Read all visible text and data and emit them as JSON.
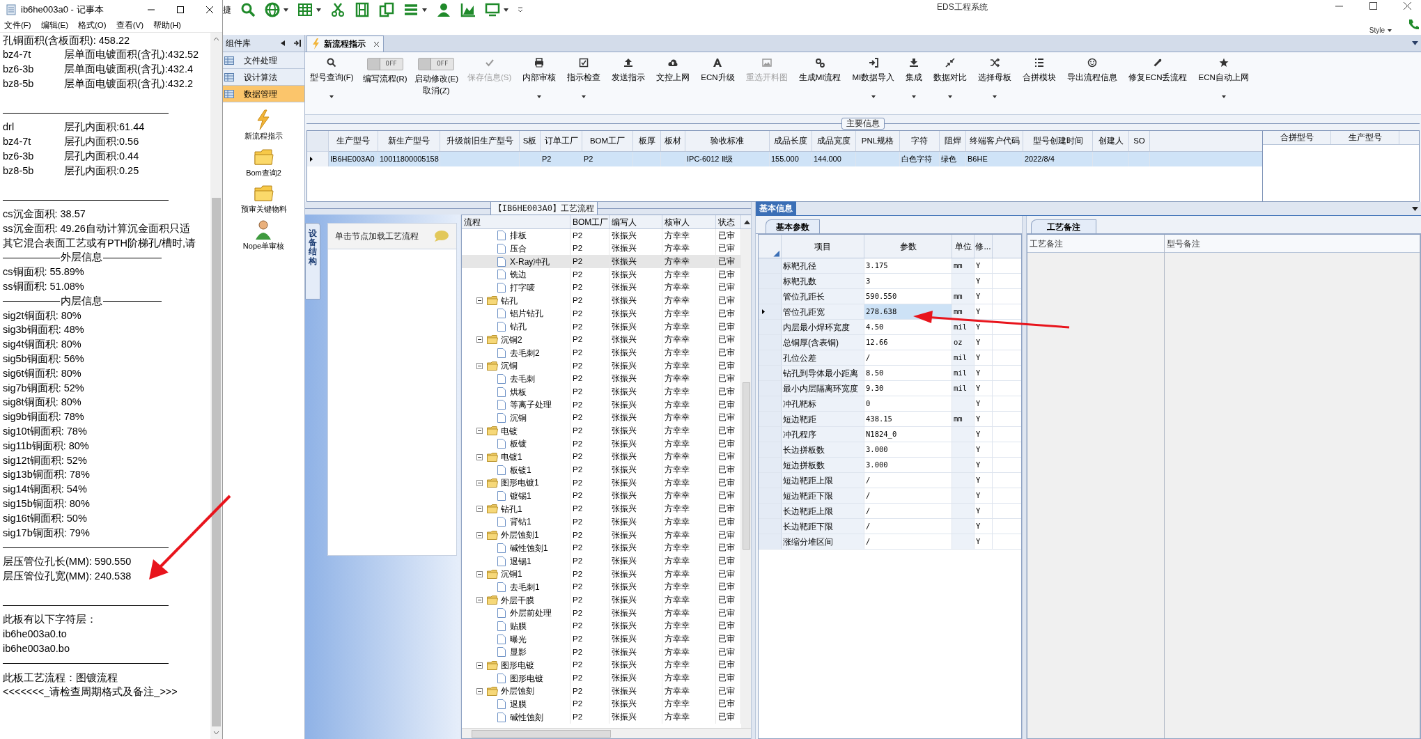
{
  "notepad": {
    "title": "ib6he003a0 - 记事本",
    "menu": [
      "文件(F)",
      "编辑(E)",
      "格式(O)",
      "查看(V)",
      "帮助(H)"
    ],
    "lines": [
      {
        "kind": "text",
        "text": "孔铜面积(含板面积): 458.22"
      },
      {
        "kind": "pair",
        "key": "bz4-7t",
        "text": "层单面电镀面积(含孔):432.52"
      },
      {
        "kind": "pair",
        "key": "bz6-3b",
        "text": "层单面电镀面积(含孔):432.4"
      },
      {
        "kind": "pair",
        "key": "bz8-5b",
        "text": "层单面电镀面积(含孔):432.2"
      },
      {
        "kind": "blank"
      },
      {
        "kind": "rule"
      },
      {
        "kind": "pair",
        "key": "drl",
        "text": "层孔内面积:61.44"
      },
      {
        "kind": "pair",
        "key": "bz4-7t",
        "text": "层孔内面积:0.56"
      },
      {
        "kind": "pair",
        "key": "bz6-3b",
        "text": "层孔内面积:0.44"
      },
      {
        "kind": "pair",
        "key": "bz8-5b",
        "text": "层孔内面积:0.25"
      },
      {
        "kind": "blank"
      },
      {
        "kind": "rule"
      },
      {
        "kind": "text",
        "text": "cs沉金面积: 38.57"
      },
      {
        "kind": "text",
        "text": "ss沉金面积: 49.26自动计算沉金面积只适"
      },
      {
        "kind": "text",
        "text": "其它混合表面工艺或有PTH阶梯孔/槽时,请"
      },
      {
        "kind": "section",
        "text": "外层信息"
      },
      {
        "kind": "text",
        "text": "cs铜面积: 55.89%"
      },
      {
        "kind": "text",
        "text": "ss铜面积: 51.08%"
      },
      {
        "kind": "section",
        "text": "内层信息"
      },
      {
        "kind": "text",
        "text": "sig2t铜面积: 80%"
      },
      {
        "kind": "text",
        "text": "sig3b铜面积: 48%"
      },
      {
        "kind": "text",
        "text": "sig4t铜面积: 80%"
      },
      {
        "kind": "text",
        "text": "sig5b铜面积: 56%"
      },
      {
        "kind": "text",
        "text": "sig6t铜面积: 80%"
      },
      {
        "kind": "text",
        "text": "sig7b铜面积: 52%"
      },
      {
        "kind": "text",
        "text": "sig8t铜面积: 80%"
      },
      {
        "kind": "text",
        "text": "sig9b铜面积: 78%"
      },
      {
        "kind": "text",
        "text": "sig10t铜面积: 78%"
      },
      {
        "kind": "text",
        "text": "sig11b铜面积: 80%"
      },
      {
        "kind": "text",
        "text": "sig12t铜面积: 52%"
      },
      {
        "kind": "text",
        "text": "sig13b铜面积: 78%"
      },
      {
        "kind": "text",
        "text": "sig14t铜面积: 54%"
      },
      {
        "kind": "text",
        "text": "sig15b铜面积: 80%"
      },
      {
        "kind": "text",
        "text": "sig16t铜面积: 50%"
      },
      {
        "kind": "text",
        "text": "sig17b铜面积: 79%"
      },
      {
        "kind": "rule"
      },
      {
        "kind": "text",
        "text": "层压管位孔长(MM): 590.550"
      },
      {
        "kind": "text",
        "text": "层压管位孔宽(MM): 240.538"
      },
      {
        "kind": "blank"
      },
      {
        "kind": "rule"
      },
      {
        "kind": "text",
        "text": "此板有以下字符层："
      },
      {
        "kind": "text",
        "text": "ib6he003a0.to"
      },
      {
        "kind": "text",
        "text": "ib6he003a0.bo"
      },
      {
        "kind": "rule"
      },
      {
        "kind": "text",
        "text": "此板工艺流程：图镀流程"
      },
      {
        "kind": "text",
        "text": "<<<<<<<_请检查周期格式及备注_>>>"
      }
    ]
  },
  "app": {
    "title": "EDS工程系统",
    "quick_label": "捷",
    "style_label": "Style"
  },
  "sidebar": {
    "title": "组件库",
    "items": [
      {
        "label": "文件处理",
        "selected": false
      },
      {
        "label": "设计算法",
        "selected": false
      },
      {
        "label": "数据管理",
        "selected": true
      }
    ],
    "tools": [
      {
        "label": "新流程指示",
        "kind": "lightning"
      },
      {
        "label": "Bom查询2",
        "kind": "folder"
      },
      {
        "label": "预审关键物料",
        "kind": "folder"
      },
      {
        "label": "Nope单审核",
        "kind": "person"
      }
    ]
  },
  "tabs": [
    {
      "label": "新流程指示",
      "selected": true
    }
  ],
  "ribbon": [
    {
      "kind": "button",
      "label": "型号查询(F)",
      "dropdown": true,
      "disabled": false
    },
    {
      "kind": "toggle",
      "label": "编写流程(R)",
      "state_text": "OFF",
      "on": false
    },
    {
      "kind": "toggle",
      "label": "启动修改(E)",
      "state_text": "OFF",
      "on": false,
      "extra": "取消(Z)"
    },
    {
      "kind": "button",
      "label": "保存信息(S)",
      "dropdown": false,
      "disabled": true
    },
    {
      "kind": "button",
      "label": "内部审核",
      "dropdown": true,
      "disabled": false
    },
    {
      "kind": "button",
      "label": "指示检查",
      "dropdown": true,
      "disabled": false
    },
    {
      "kind": "button",
      "label": "发送指示",
      "dropdown": false,
      "disabled": false
    },
    {
      "kind": "button",
      "label": "文控上网",
      "dropdown": false,
      "disabled": false
    },
    {
      "kind": "button",
      "label": "ECN升级",
      "dropdown": false,
      "disabled": false
    },
    {
      "kind": "button",
      "label": "重选开料图",
      "dropdown": false,
      "disabled": true
    },
    {
      "kind": "button",
      "label": "生成MI流程",
      "dropdown": false,
      "disabled": false
    },
    {
      "kind": "button",
      "label": "MI数据导入",
      "dropdown": true,
      "disabled": false
    },
    {
      "kind": "button",
      "label": "集成",
      "dropdown": true,
      "disabled": false
    },
    {
      "kind": "button",
      "label": "数据对比",
      "dropdown": true,
      "disabled": false
    },
    {
      "kind": "button",
      "label": "选择母板",
      "dropdown": true,
      "disabled": false
    },
    {
      "kind": "button",
      "label": "合拼模块",
      "dropdown": false,
      "disabled": false
    },
    {
      "kind": "button",
      "label": "导出流程信息",
      "dropdown": false,
      "disabled": false
    },
    {
      "kind": "button",
      "label": "修复ECN丢流程",
      "dropdown": false,
      "disabled": false
    },
    {
      "kind": "button",
      "label": "ECN自动上网",
      "dropdown": true,
      "disabled": false
    }
  ],
  "main_info": {
    "title": "主要信息",
    "columns": [
      "生产型号",
      "新生产型号",
      "升级前旧生产型号",
      "S板",
      "订单工厂",
      "BOM工厂",
      "板厚",
      "板材",
      "验收标准",
      "成品长度",
      "成品宽度",
      "PNL规格",
      "字符",
      "阻焊",
      "终端客户代码",
      "型号创建时间",
      "创建人",
      "SO"
    ],
    "rows": [
      {
        "selected": true,
        "cells": [
          "IB6HE003A0",
          "10011800005158",
          null,
          null,
          "P2",
          "P2",
          null,
          null,
          "IPC-6012 Ⅱ级",
          "155.000",
          "144.000",
          null,
          "白色字符",
          "绿色",
          "B6HE",
          "2022/8/4",
          null,
          null
        ]
      }
    ],
    "side_columns": [
      "合拼型号",
      "生产型号"
    ]
  },
  "process": {
    "title": "【IB6HE003A0】工艺流程",
    "side_tab": "设备结构",
    "hint": "单击节点加载工艺流程",
    "tree_column": "流程",
    "columns": [
      "BOM工厂",
      "编写人",
      "核审人",
      "状态"
    ],
    "rows": [
      {
        "kind": "leaf",
        "label": "排板",
        "selected": false,
        "cells": [
          "P2",
          "张振兴",
          "方幸幸",
          "已审"
        ]
      },
      {
        "kind": "leaf",
        "label": "压合",
        "selected": false,
        "cells": [
          "P2",
          "张振兴",
          "方幸幸",
          "已审"
        ]
      },
      {
        "kind": "leaf",
        "label": "X-Ray冲孔",
        "selected": true,
        "cells": [
          "P2",
          "张振兴",
          "方幸幸",
          "已审"
        ]
      },
      {
        "kind": "leaf",
        "label": "铣边",
        "selected": false,
        "cells": [
          "P2",
          "张振兴",
          "方幸幸",
          "已审"
        ]
      },
      {
        "kind": "leaf",
        "label": "打字唛",
        "selected": false,
        "cells": [
          "P2",
          "张振兴",
          "方幸幸",
          "已审"
        ]
      },
      {
        "kind": "folder",
        "label": "钻孔",
        "expanded": true,
        "selected": false,
        "cells": [
          "P2",
          "张振兴",
          "方幸幸",
          "已审"
        ],
        "children": [
          {
            "kind": "leaf",
            "label": "铝片钻孔",
            "selected": false,
            "cells": [
              "P2",
              "张振兴",
              "方幸幸",
              "已审"
            ]
          },
          {
            "kind": "leaf",
            "label": "钻孔",
            "selected": false,
            "cells": [
              "P2",
              "张振兴",
              "方幸幸",
              "已审"
            ]
          }
        ]
      },
      {
        "kind": "folder",
        "label": "沉铜2",
        "expanded": true,
        "selected": false,
        "cells": [
          "P2",
          "张振兴",
          "方幸幸",
          "已审"
        ],
        "children": [
          {
            "kind": "leaf",
            "label": "去毛刺2",
            "selected": false,
            "cells": [
              "P2",
              "张振兴",
              "方幸幸",
              "已审"
            ]
          }
        ]
      },
      {
        "kind": "folder",
        "label": "沉铜",
        "expanded": true,
        "selected": false,
        "cells": [
          "P2",
          "张振兴",
          "方幸幸",
          "已审"
        ],
        "children": [
          {
            "kind": "leaf",
            "label": "去毛刺",
            "selected": false,
            "cells": [
              "P2",
              "张振兴",
              "方幸幸",
              "已审"
            ]
          },
          {
            "kind": "leaf",
            "label": "烘板",
            "selected": false,
            "cells": [
              "P2",
              "张振兴",
              "方幸幸",
              "已审"
            ]
          },
          {
            "kind": "leaf",
            "label": "等离子处理",
            "selected": false,
            "cells": [
              "P2",
              "张振兴",
              "方幸幸",
              "已审"
            ]
          },
          {
            "kind": "leaf",
            "label": "沉铜",
            "selected": false,
            "cells": [
              "P2",
              "张振兴",
              "方幸幸",
              "已审"
            ]
          }
        ]
      },
      {
        "kind": "folder",
        "label": "电镀",
        "expanded": true,
        "selected": false,
        "cells": [
          "P2",
          "张振兴",
          "方幸幸",
          "已审"
        ],
        "children": [
          {
            "kind": "leaf",
            "label": "板镀",
            "selected": false,
            "cells": [
              "P2",
              "张振兴",
              "方幸幸",
              "已审"
            ]
          }
        ]
      },
      {
        "kind": "folder",
        "label": "电镀1",
        "expanded": true,
        "selected": false,
        "cells": [
          "P2",
          "张振兴",
          "方幸幸",
          "已审"
        ],
        "children": [
          {
            "kind": "leaf",
            "label": "板镀1",
            "selected": false,
            "cells": [
              "P2",
              "张振兴",
              "方幸幸",
              "已审"
            ]
          }
        ]
      },
      {
        "kind": "folder",
        "label": "图形电镀1",
        "expanded": true,
        "selected": false,
        "cells": [
          "P2",
          "张振兴",
          "方幸幸",
          "已审"
        ],
        "children": [
          {
            "kind": "leaf",
            "label": "镀锡1",
            "selected": false,
            "cells": [
              "P2",
              "张振兴",
              "方幸幸",
              "已审"
            ]
          }
        ]
      },
      {
        "kind": "folder",
        "label": "钻孔1",
        "expanded": true,
        "selected": false,
        "cells": [
          "P2",
          "张振兴",
          "方幸幸",
          "已审"
        ],
        "children": [
          {
            "kind": "leaf",
            "label": "背钻1",
            "selected": false,
            "cells": [
              "P2",
              "张振兴",
              "方幸幸",
              "已审"
            ]
          }
        ]
      },
      {
        "kind": "folder",
        "label": "外层蚀刻1",
        "expanded": true,
        "selected": false,
        "cells": [
          "P2",
          "张振兴",
          "方幸幸",
          "已审"
        ],
        "children": [
          {
            "kind": "leaf",
            "label": "碱性蚀刻1",
            "selected": false,
            "cells": [
              "P2",
              "张振兴",
              "方幸幸",
              "已审"
            ]
          },
          {
            "kind": "leaf",
            "label": "退锡1",
            "selected": false,
            "cells": [
              "P2",
              "张振兴",
              "方幸幸",
              "已审"
            ]
          }
        ]
      },
      {
        "kind": "folder",
        "label": "沉铜1",
        "expanded": true,
        "selected": false,
        "cells": [
          "P2",
          "张振兴",
          "方幸幸",
          "已审"
        ],
        "children": [
          {
            "kind": "leaf",
            "label": "去毛刺1",
            "selected": false,
            "cells": [
              "P2",
              "张振兴",
              "方幸幸",
              "已审"
            ]
          }
        ]
      },
      {
        "kind": "folder",
        "label": "外层干膜",
        "expanded": true,
        "selected": false,
        "cells": [
          "P2",
          "张振兴",
          "方幸幸",
          "已审"
        ],
        "children": [
          {
            "kind": "leaf",
            "label": "外层前处理",
            "selected": false,
            "cells": [
              "P2",
              "张振兴",
              "方幸幸",
              "已审"
            ]
          },
          {
            "kind": "leaf",
            "label": "贴膜",
            "selected": false,
            "cells": [
              "P2",
              "张振兴",
              "方幸幸",
              "已审"
            ]
          },
          {
            "kind": "leaf",
            "label": "曝光",
            "selected": false,
            "cells": [
              "P2",
              "张振兴",
              "方幸幸",
              "已审"
            ]
          },
          {
            "kind": "leaf",
            "label": "显影",
            "selected": false,
            "cells": [
              "P2",
              "张振兴",
              "方幸幸",
              "已审"
            ]
          }
        ]
      },
      {
        "kind": "folder",
        "label": "图形电镀",
        "expanded": true,
        "selected": false,
        "cells": [
          "P2",
          "张振兴",
          "方幸幸",
          "已审"
        ],
        "children": [
          {
            "kind": "leaf",
            "label": "图形电镀",
            "selected": false,
            "cells": [
              "P2",
              "张振兴",
              "方幸幸",
              "已审"
            ]
          }
        ]
      },
      {
        "kind": "folder",
        "label": "外层蚀刻",
        "expanded": true,
        "selected": false,
        "cells": [
          "P2",
          "张振兴",
          "方幸幸",
          "已审"
        ],
        "children": [
          {
            "kind": "leaf",
            "label": "退膜",
            "selected": false,
            "cells": [
              "P2",
              "张振兴",
              "方幸幸",
              "已审"
            ]
          },
          {
            "kind": "leaf",
            "label": "碱性蚀刻",
            "selected": false,
            "cells": [
              "P2",
              "张振兴",
              "方幸幸",
              "已审"
            ]
          }
        ]
      }
    ]
  },
  "basic_info": {
    "title": "基本信息",
    "tab": "基本参数",
    "columns": [
      "项目",
      "参数",
      "单位",
      "修..."
    ],
    "rows": [
      {
        "item": "标靶孔径",
        "value": "3.175",
        "unit": "mm",
        "flag": "Y",
        "selected": false
      },
      {
        "item": "标靶孔数",
        "value": "3",
        "flag": "Y",
        "selected": false
      },
      {
        "item": "管位孔距长",
        "value": "590.550",
        "unit": "mm",
        "flag": "Y",
        "selected": false
      },
      {
        "item": "管位孔距宽",
        "value": "278.638",
        "unit": "mm",
        "flag": "Y",
        "selected": true
      },
      {
        "item": "内层最小焊环宽度",
        "value": "4.50",
        "unit": "mil",
        "flag": "Y",
        "selected": false
      },
      {
        "item": "总铜厚(含表铜)",
        "value": "12.66",
        "unit": "oz",
        "flag": "Y",
        "selected": false
      },
      {
        "item": "孔位公差",
        "value": "/",
        "unit": "mil",
        "flag": "Y",
        "selected": false
      },
      {
        "item": "钻孔到导体最小距离",
        "value": "8.50",
        "unit": "mil",
        "flag": "Y",
        "selected": false
      },
      {
        "item": "最小内层隔离环宽度",
        "value": "9.30",
        "unit": "mil",
        "flag": "Y",
        "selected": false
      },
      {
        "item": "冲孔靶标",
        "value": "0",
        "flag": "Y",
        "selected": false
      },
      {
        "item": "短边靶距",
        "value": "438.15",
        "unit": "mm",
        "flag": "Y",
        "selected": false
      },
      {
        "item": "冲孔程序",
        "value": "N1824_0",
        "flag": "Y",
        "selected": false
      },
      {
        "item": "长边拼板数",
        "value": "3.000",
        "flag": "Y",
        "selected": false
      },
      {
        "item": "短边拼板数",
        "value": "3.000",
        "flag": "Y",
        "selected": false
      },
      {
        "item": "短边靶距上限",
        "value": "/",
        "flag": "Y",
        "selected": false
      },
      {
        "item": "短边靶距下限",
        "value": "/",
        "flag": "Y",
        "selected": false
      },
      {
        "item": "长边靶距上限",
        "value": "/",
        "flag": "Y",
        "selected": false
      },
      {
        "item": "长边靶距下限",
        "value": "/",
        "flag": "Y",
        "selected": false
      },
      {
        "item": "涨缩分堆区间",
        "value": "/",
        "flag": "Y",
        "selected": false
      }
    ]
  },
  "notes": {
    "tab": "工艺备注",
    "columns": [
      "工艺备注",
      "型号备注"
    ]
  }
}
